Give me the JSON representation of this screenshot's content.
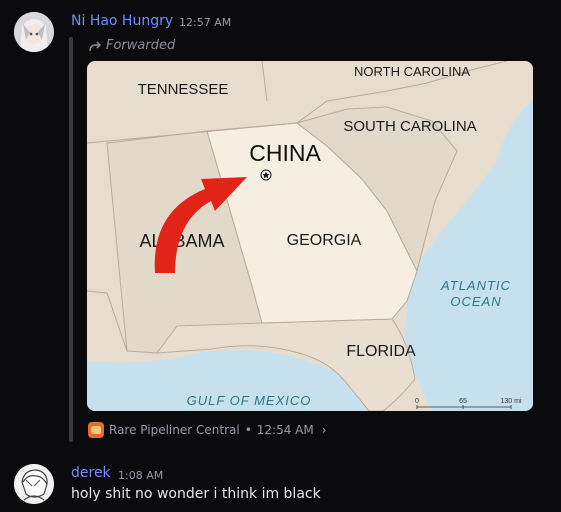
{
  "message1": {
    "username": "Ni Hao Hungry",
    "time": "12:57 AM",
    "forwarded_label": "Forwarded",
    "map": {
      "state_labels": [
        "TENNESSEE",
        "NORTH CAROLINA",
        "SOUTH CAROLINA",
        "ALABAMA",
        "GEORGIA",
        "FLORIDA"
      ],
      "highlight_label": "CHINA",
      "ocean_labels": [
        "ATLANTIC",
        "OCEAN"
      ],
      "gulf_label": "GULF OF MEXICO",
      "scale_labels": [
        "0",
        "65",
        "130 mi"
      ]
    },
    "source": {
      "server": "Rare Pipeliner Central",
      "separator": "•",
      "time": "12:54 AM",
      "chevron": "›"
    }
  },
  "message2": {
    "username": "derek",
    "time": "1:08 AM",
    "text": "holy shit no wonder i think im black"
  },
  "colors": {
    "username": "#6c8cff",
    "background": "#0b0b0d",
    "arrow": "#e2231a"
  }
}
